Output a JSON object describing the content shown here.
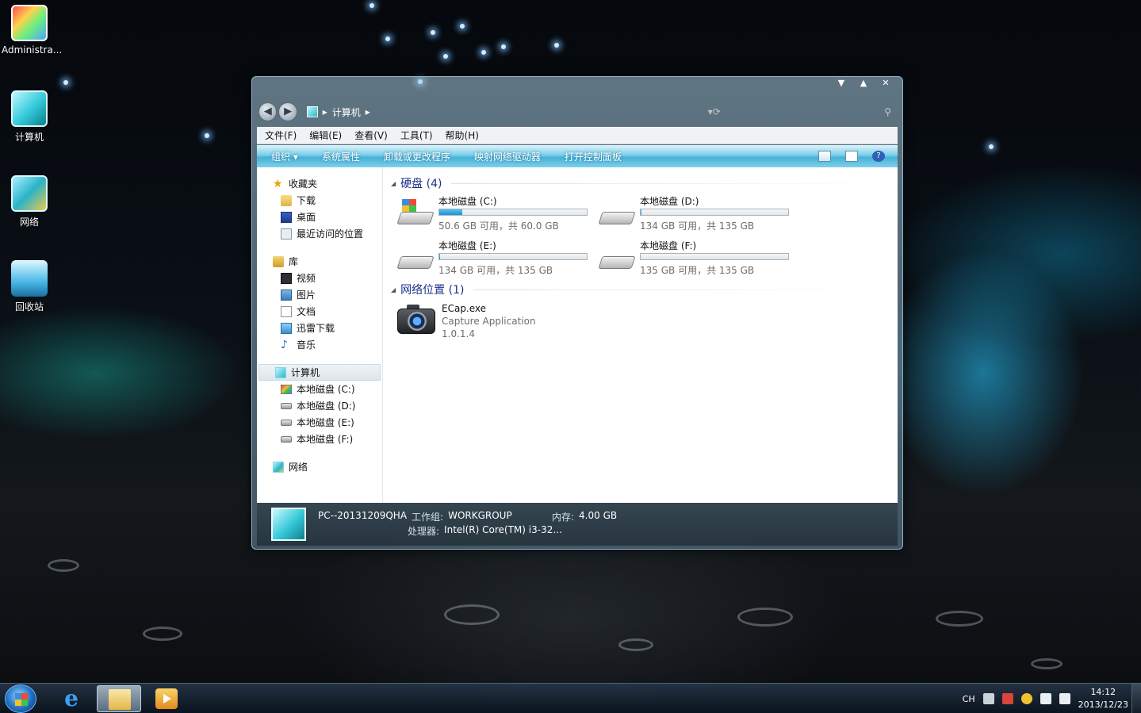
{
  "desktop": {
    "icons": [
      {
        "label": "Administra..."
      },
      {
        "label": "计算机"
      },
      {
        "label": "网络"
      },
      {
        "label": "回收站"
      }
    ]
  },
  "window": {
    "controls": {
      "min": "▼",
      "max": "▲",
      "close": "✕"
    },
    "address": {
      "segment": "计算机"
    },
    "menu": [
      "文件(F)",
      "编辑(E)",
      "查看(V)",
      "工具(T)",
      "帮助(H)"
    ],
    "toolbar": [
      "组织 ▾",
      "系统属性",
      "卸载或更改程序",
      "映射网络驱动器",
      "打开控制面板"
    ],
    "nav": {
      "favorites": {
        "title": "收藏夹",
        "items": [
          "下载",
          "桌面",
          "最近访问的位置"
        ]
      },
      "libraries": {
        "title": "库",
        "items": [
          "视频",
          "图片",
          "文档",
          "迅雷下载",
          "音乐"
        ]
      },
      "computer": {
        "title": "计算机",
        "items": [
          "本地磁盘 (C:)",
          "本地磁盘 (D:)",
          "本地磁盘 (E:)",
          "本地磁盘 (F:)"
        ]
      },
      "network": {
        "title": "网络"
      }
    },
    "sections": {
      "hard_disks": {
        "title": "硬盘 (4)"
      },
      "network_locations": {
        "title": "网络位置 (1)"
      }
    },
    "drives": [
      {
        "name": "本地磁盘 (C:)",
        "free": "50.6 GB 可用，共 60.0 GB",
        "used_fraction": 0.157
      },
      {
        "name": "本地磁盘 (D:)",
        "free": "134 GB 可用，共 135 GB",
        "used_fraction": 0.007
      },
      {
        "name": "本地磁盘 (E:)",
        "free": "134 GB 可用，共 135 GB",
        "used_fraction": 0.007
      },
      {
        "name": "本地磁盘 (F:)",
        "free": "135 GB 可用，共 135 GB",
        "used_fraction": 0.0
      }
    ],
    "network_item": {
      "name": "ECap.exe",
      "description": "Capture Application",
      "version": "1.0.1.4"
    },
    "details": {
      "pc_name": "PC--20131209QHA",
      "workgroup_label": "工作组:",
      "workgroup": "WORKGROUP",
      "memory_label": "内存:",
      "memory": "4.00 GB",
      "processor_label": "处理器:",
      "processor": "Intel(R) Core(TM) i3-32..."
    }
  },
  "taskbar": {
    "tray": {
      "lang": "CH",
      "time": "14:12",
      "date": "2013/12/23"
    }
  }
}
